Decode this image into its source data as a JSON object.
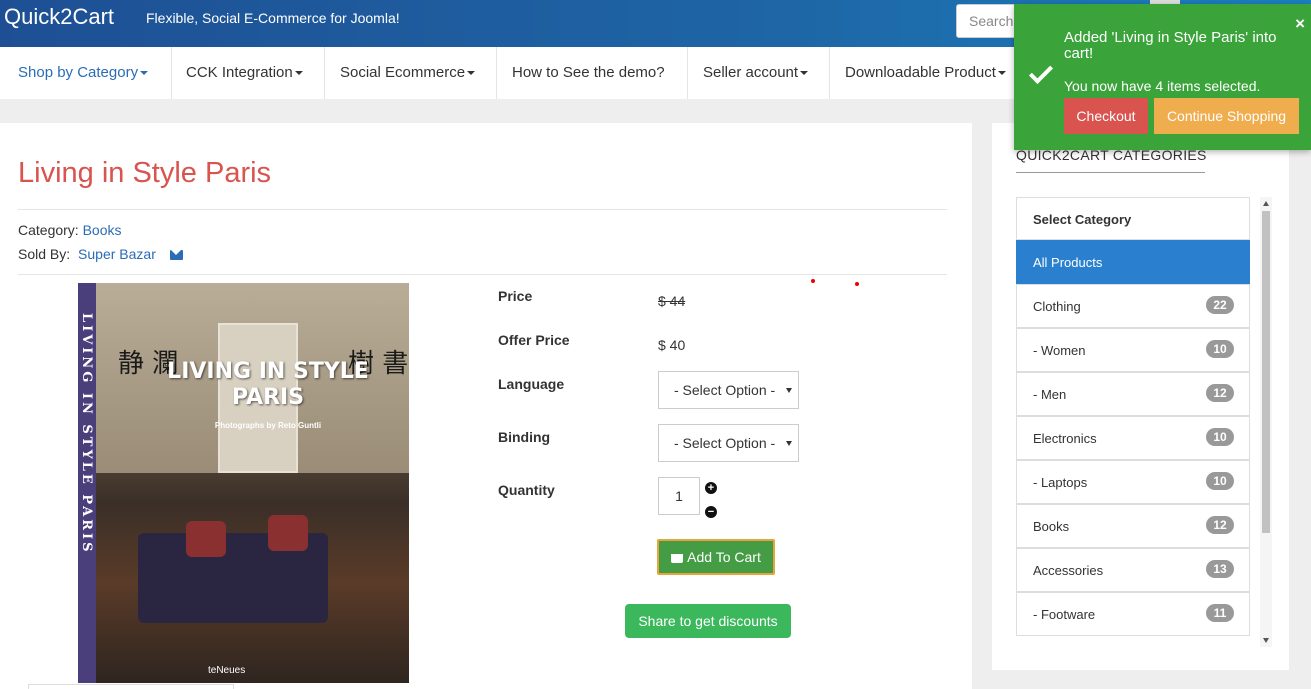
{
  "header": {
    "brand": "Quick2Cart",
    "tagline": "Flexible, Social E-Commerce for Joomla!",
    "search_placeholder": "Search"
  },
  "nav": {
    "items": [
      {
        "label": "Shop by Category",
        "dropdown": true
      },
      {
        "label": "CCK Integration",
        "dropdown": true
      },
      {
        "label": "Social Ecommerce",
        "dropdown": true
      },
      {
        "label": "How to See the demo?",
        "dropdown": false
      },
      {
        "label": "Seller account",
        "dropdown": true
      },
      {
        "label": "Downloadable Product",
        "dropdown": true
      }
    ]
  },
  "product": {
    "title": "Living in Style Paris",
    "category_label": "Category:",
    "category_value": "Books",
    "sold_by_label": "Sold By:",
    "seller": "Super Bazar",
    "cover": {
      "title": "LIVING IN STYLE PARIS",
      "subtitle": "Photographs by Reto Guntli",
      "spine": "LIVING IN STYLE PARIS",
      "publisher": "teNeues",
      "calligraphy_left": "静 瀾",
      "calligraphy_right": "樹 書"
    },
    "price_label": "Price",
    "price": "$ 44",
    "offer_label": "Offer Price",
    "offer_price": "$ 40",
    "language_label": "Language",
    "language_value": "- Select Option -",
    "binding_label": "Binding",
    "binding_value": "- Select Option -",
    "quantity_label": "Quantity",
    "quantity": "1",
    "add_to_cart": "Add To Cart",
    "share": "Share to get discounts"
  },
  "sidebar": {
    "heading": "QUICK2CART CATEGORIES",
    "header_item": "Select Category",
    "categories": [
      {
        "label": "All Products",
        "count": "",
        "active": true
      },
      {
        "label": "Clothing",
        "count": "22"
      },
      {
        "label": "- Women",
        "count": "10"
      },
      {
        "label": "- Men",
        "count": "12"
      },
      {
        "label": "Electronics",
        "count": "10"
      },
      {
        "label": "- Laptops",
        "count": "10"
      },
      {
        "label": "Books",
        "count": "12"
      },
      {
        "label": "Accessories",
        "count": "13"
      },
      {
        "label": "- Footware",
        "count": "11"
      }
    ]
  },
  "toast": {
    "message": "Added 'Living in Style Paris' into cart!",
    "count_text": "You now have 4 items selected.",
    "checkout": "Checkout",
    "continue": "Continue Shopping",
    "close": "×"
  },
  "colors": {
    "title_red": "#d9534f",
    "link_blue": "#2a6db5",
    "toast_green": "#3aa33a",
    "active_blue": "#2a7fcf"
  }
}
